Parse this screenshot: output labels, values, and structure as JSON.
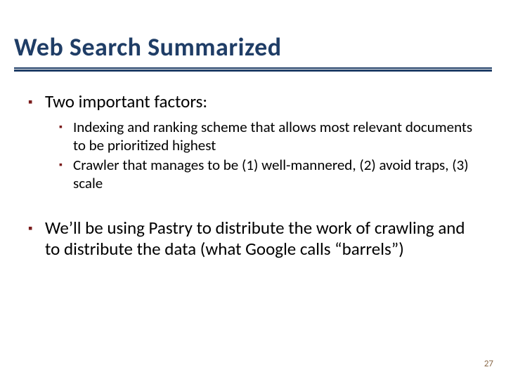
{
  "colors": {
    "title": "#1f3d66",
    "rule": "#1f3d66",
    "bullet": "#7a1c1c",
    "pagenum": "#8a6a4a"
  },
  "title": "Web Search Summarized",
  "bullets": {
    "a": "Two important factors:",
    "a_sub": {
      "i": "Indexing and ranking scheme that allows most relevant documents to be prioritized highest",
      "ii": "Crawler that manages to be (1) well-mannered, (2) avoid traps, (3) scale"
    },
    "b": "We’ll be using Pastry to distribute the work of crawling and to distribute the data (what Google calls “barrels”)"
  },
  "page_number": "27"
}
